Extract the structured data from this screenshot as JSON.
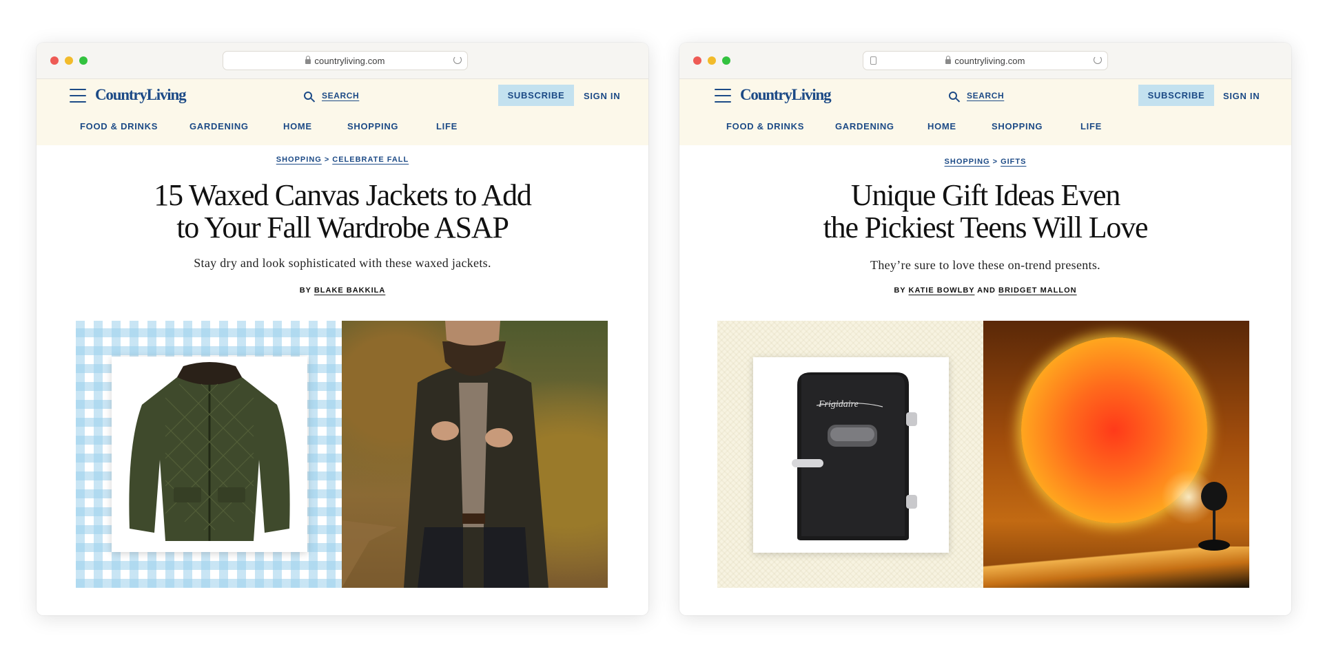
{
  "windows": [
    {
      "url": "countryliving.com",
      "logo": "CountryLiving",
      "search_label": "SEARCH",
      "subscribe_label": "SUBSCRIBE",
      "signin_label": "SIGN IN",
      "nav": [
        "FOOD & DRINKS",
        "GARDENING",
        "HOME",
        "SHOPPING",
        "LIFE"
      ],
      "breadcrumb": [
        "SHOPPING",
        "CELEBRATE FALL"
      ],
      "breadcrumb_separator": ">",
      "headline_lines": [
        "15 Waxed Canvas Jackets to Add",
        "to Your Fall Wardrobe ASAP"
      ],
      "dek": "Stay dry and look sophisticated with these waxed jackets.",
      "byline_prefix": "BY",
      "authors": [
        "BLAKE BAKKILA"
      ]
    },
    {
      "url": "countryliving.com",
      "logo": "CountryLiving",
      "search_label": "SEARCH",
      "subscribe_label": "SUBSCRIBE",
      "signin_label": "SIGN IN",
      "nav": [
        "FOOD & DRINKS",
        "GARDENING",
        "HOME",
        "SHOPPING",
        "LIFE"
      ],
      "breadcrumb": [
        "SHOPPING",
        "GIFTS"
      ],
      "breadcrumb_separator": ">",
      "headline_lines": [
        "Unique Gift Ideas Even",
        "the Pickiest Teens Will Love"
      ],
      "dek": "They’re sure to love these on-trend presents.",
      "byline_prefix": "BY",
      "authors": [
        "KATIE BOWLBY",
        "BRIDGET MALLON"
      ],
      "author_joiner": "AND",
      "fridge_brand": "Frigidaire"
    }
  ],
  "colors": {
    "brand_blue": "#1c4a86",
    "header_bg": "#fcf8ea",
    "subscribe_bg": "#c3e1ef"
  }
}
